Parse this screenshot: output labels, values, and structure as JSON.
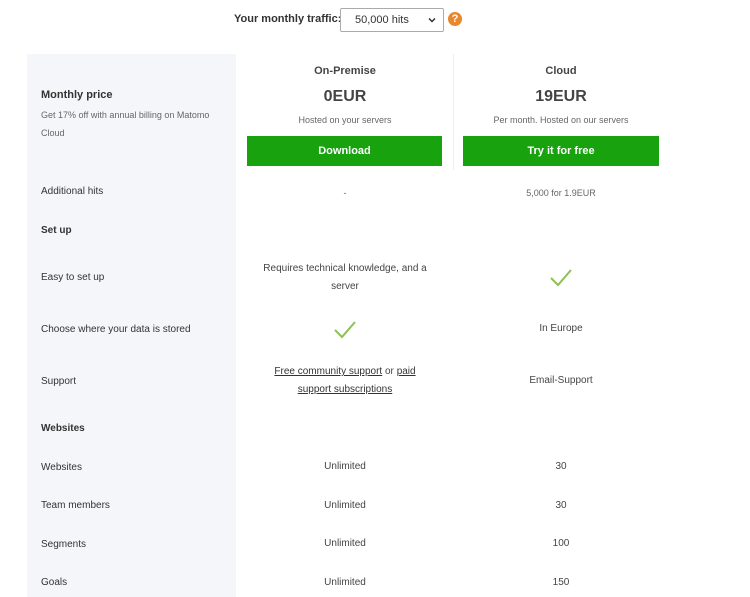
{
  "traffic": {
    "label": "Your monthly traffic:",
    "selected": "50,000 hits",
    "help_symbol": "?"
  },
  "pricing_header": {
    "title": "Monthly price",
    "subtitle": "Get 17% off with annual billing on Matomo Cloud"
  },
  "plans": [
    {
      "name": "On-Premise",
      "price": "0EUR",
      "subtitle": "Hosted on your servers",
      "button": "Download"
    },
    {
      "name": "Cloud",
      "price": "19EUR",
      "subtitle": "Per month. Hosted on our servers",
      "button": "Try it for free"
    }
  ],
  "rows": {
    "additional_hits": {
      "label": "Additional hits",
      "on_premise": "-",
      "cloud": "5,000 for 1.9EUR"
    },
    "setup_section": {
      "label": "Set up"
    },
    "easy_setup": {
      "label": "Easy to set up",
      "on_premise": "Requires technical knowledge, and a server",
      "cloud_check": true
    },
    "data_stored": {
      "label": "Choose where your data is stored",
      "on_premise_check": true,
      "cloud": "In Europe"
    },
    "support": {
      "label": "Support",
      "on_premise_link1": "Free community support",
      "on_premise_or": "or",
      "on_premise_link2_part1": "paid",
      "on_premise_link2_part2": "support subscriptions",
      "cloud": "Email-Support"
    },
    "websites_section": {
      "label": "Websites"
    },
    "websites": {
      "label": "Websites",
      "on_premise": "Unlimited",
      "cloud": "30"
    },
    "team_members": {
      "label": "Team members",
      "on_premise": "Unlimited",
      "cloud": "30"
    },
    "segments": {
      "label": "Segments",
      "on_premise": "Unlimited",
      "cloud": "100"
    },
    "goals": {
      "label": "Goals",
      "on_premise": "Unlimited",
      "cloud": "150"
    }
  },
  "colors": {
    "accent_green": "#17a20e",
    "check_green": "#8cc152",
    "help_orange": "#e8872b",
    "feature_bg": "#f4f6fa"
  }
}
